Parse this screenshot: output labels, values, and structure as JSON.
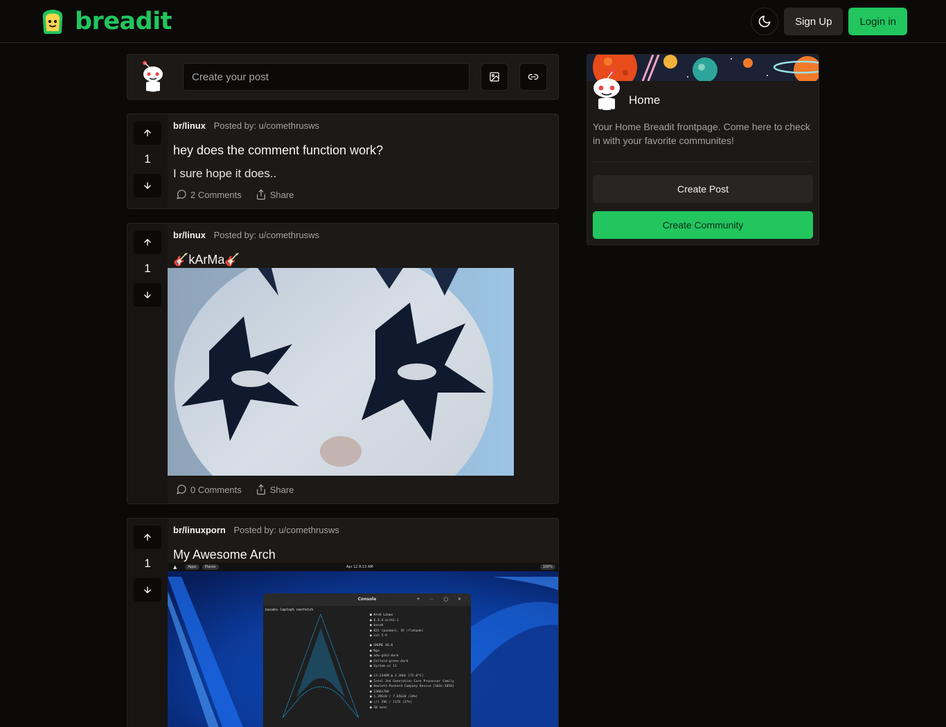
{
  "brand": {
    "name": "breadit",
    "accent": "#22c55e"
  },
  "nav": {
    "signup_label": "Sign Up",
    "login_label": "Login in"
  },
  "composer": {
    "placeholder": "Create your post"
  },
  "posts": [
    {
      "subreddit": "br/linux",
      "posted_by": "Posted by: u/comethrusws",
      "votes": "1",
      "title": "hey does the comment function work?",
      "body": "I sure hope it does..",
      "comments": "2 Comments",
      "share": "Share"
    },
    {
      "subreddit": "br/linux",
      "posted_by": "Posted by: u/comethrusws",
      "votes": "1",
      "title": "🎸kArMa🎸",
      "image": "face-paint-photo",
      "comments": "0 Comments",
      "share": "Share"
    },
    {
      "subreddit": "br/linuxporn",
      "posted_by": "Posted by: u/comethrusws",
      "votes": "1",
      "title": "My Awesome Arch",
      "image": "desktop-screenshot",
      "screenshot": {
        "topbar_apps": "Apps",
        "topbar_places": "Places",
        "clock": "Apr 12  8:13 AM",
        "battery": "100%",
        "console_title": "Console",
        "prompt": "basabs-laptop% neofetch",
        "info_lines": [
          "Arch Linux",
          "6.8.4-arch1-1",
          "basab",
          "831 (pacman), 35 (flatpak)",
          "zsh 5.9",
          "GNOME 46.0",
          "Kgx",
          "adw-gtk3-dark",
          "Colloid-green-dark",
          "System-ui 11",
          "i3-2348M @ 2.3GHz [72.0°C]",
          "Intel 2nd Generation Core Processor Family",
          "Hewlett-Packard Company Device [103c:1858]",
          "1366x768",
          "1.39GiB / 7.65GiB (18%)",
          "(/)  29G / 117G (27%)",
          "38 mins"
        ]
      }
    }
  ],
  "sidebar": {
    "title": "Home",
    "description": "Your Home Breadit frontpage. Come here to check in with your favorite communites!",
    "create_post_label": "Create Post",
    "create_community_label": "Create Community"
  }
}
